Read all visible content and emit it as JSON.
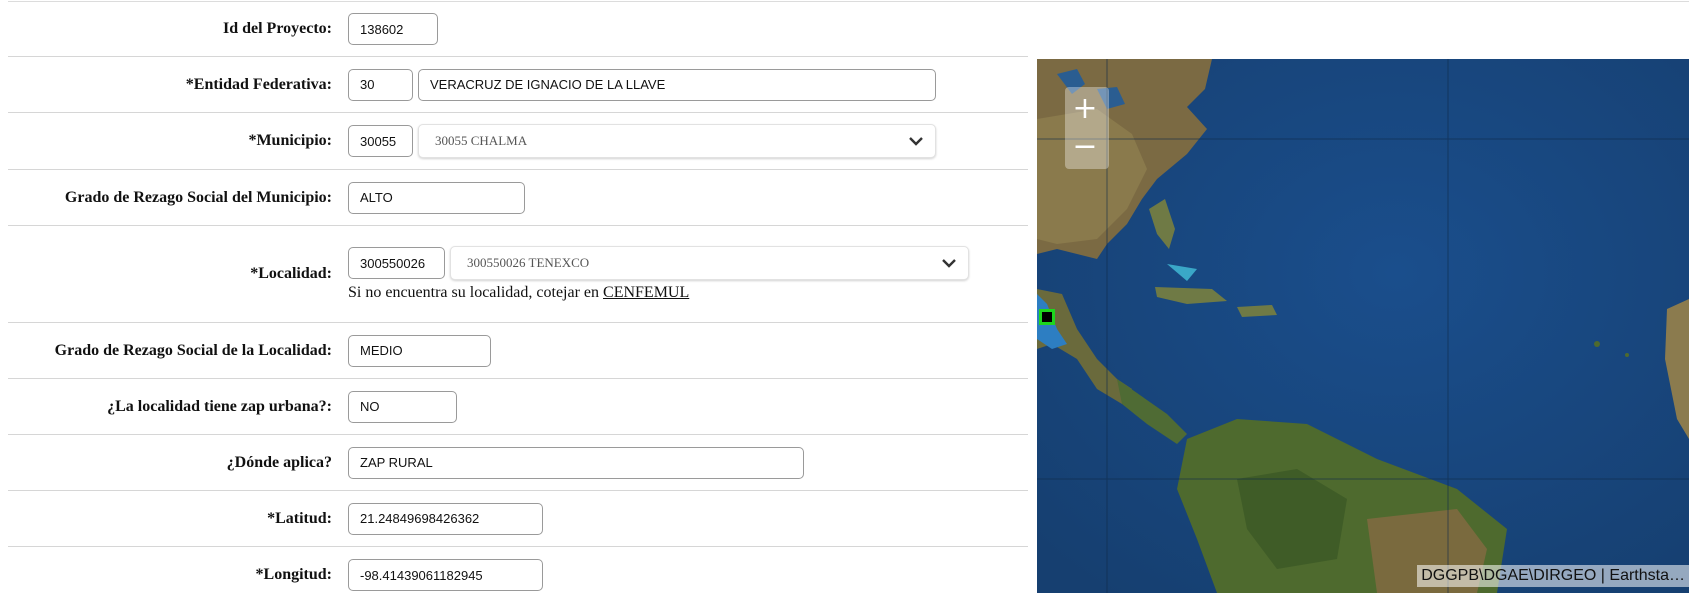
{
  "form": {
    "id_proyecto": {
      "label": "Id del Proyecto:",
      "value": "138602"
    },
    "entidad": {
      "label": "*Entidad Federativa:",
      "code": "30",
      "name": "VERACRUZ DE IGNACIO DE LA LLAVE"
    },
    "municipio": {
      "label": "*Municipio:",
      "code": "30055",
      "selected": "30055 CHALMA"
    },
    "rezago_municipio": {
      "label": "Grado de Rezago Social del Municipio:",
      "value": "ALTO"
    },
    "localidad": {
      "label": "*Localidad:",
      "code": "300550026",
      "selected": "300550026 TENEXCO",
      "help_text": "Si no encuentra su localidad, cotejar en ",
      "help_link": "CENFEMUL"
    },
    "rezago_localidad": {
      "label": "Grado de Rezago Social de la Localidad:",
      "value": "MEDIO"
    },
    "zap_urbana": {
      "label": "¿La localidad tiene zap urbana?:",
      "value": "NO"
    },
    "donde_aplica": {
      "label": "¿Dónde aplica?",
      "value": "ZAP RURAL"
    },
    "latitud": {
      "label": "*Latitud:",
      "value": "21.24849698426362"
    },
    "longitud": {
      "label": "*Longitud:",
      "value": "-98.41439061182945"
    }
  },
  "map": {
    "zoom_in": "+",
    "zoom_out": "−",
    "attribution": "DGGPB\\DGAE\\DIRGEO | Earthsta…",
    "marker_color": "#1ed61e"
  },
  "icons": {
    "chevron": "chevron-down-icon"
  }
}
